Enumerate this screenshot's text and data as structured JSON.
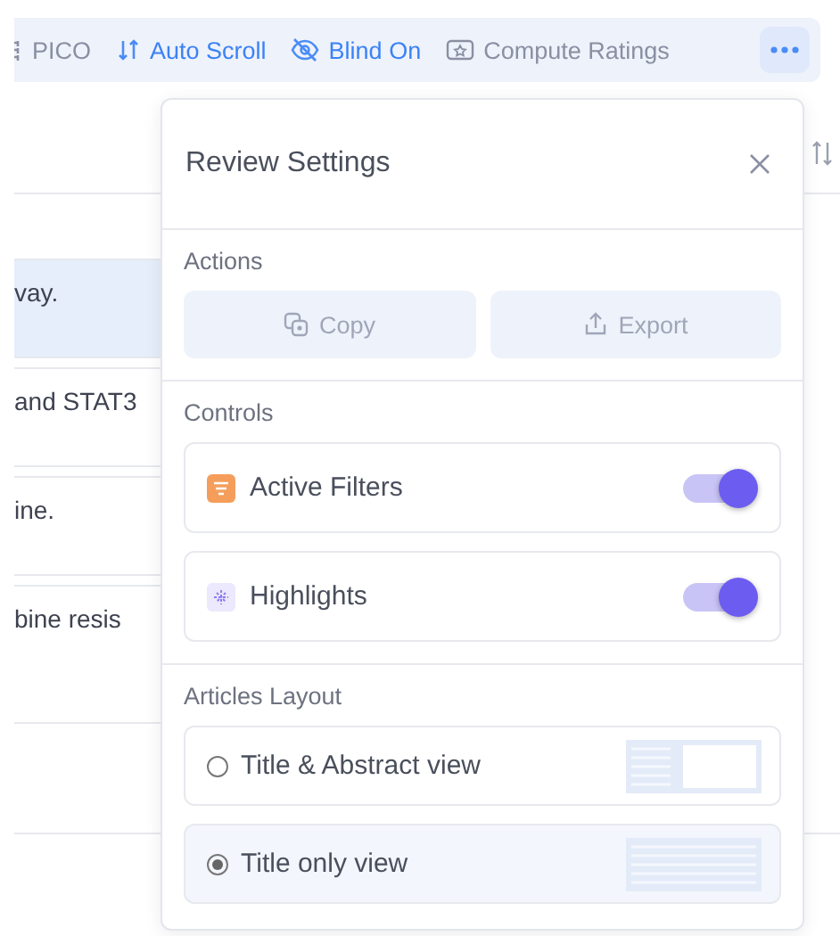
{
  "toolbar": {
    "items": [
      {
        "label": "PICO",
        "kind": "pico",
        "active": false
      },
      {
        "label": "Auto Scroll",
        "kind": "scroll",
        "active": true
      },
      {
        "label": "Blind On",
        "kind": "blind",
        "active": true
      },
      {
        "label": "Compute Ratings",
        "kind": "ratings",
        "active": false
      }
    ]
  },
  "articles": [
    {
      "text": "vay.",
      "selected": true
    },
    {
      "text": "and STAT3",
      "selected": false
    },
    {
      "text": "ine.",
      "selected": false
    },
    {
      "text": "bine resis",
      "selected": false
    }
  ],
  "panel": {
    "title": "Review Settings",
    "actions": {
      "heading": "Actions",
      "buttons": [
        {
          "label": "Copy",
          "kind": "copy"
        },
        {
          "label": "Export",
          "kind": "export"
        }
      ]
    },
    "controls": {
      "heading": "Controls",
      "items": [
        {
          "label": "Active Filters",
          "kind": "filter",
          "color": "#f59e5b",
          "on": true
        },
        {
          "label": "Highlights",
          "kind": "highlight",
          "color": "#ece8fd",
          "on": true
        }
      ]
    },
    "layout": {
      "heading": "Articles Layout",
      "options": [
        {
          "label": "Title & Abstract view",
          "kind": "abstract",
          "selected": false
        },
        {
          "label": "Title only view",
          "kind": "title",
          "selected": true
        }
      ]
    }
  }
}
